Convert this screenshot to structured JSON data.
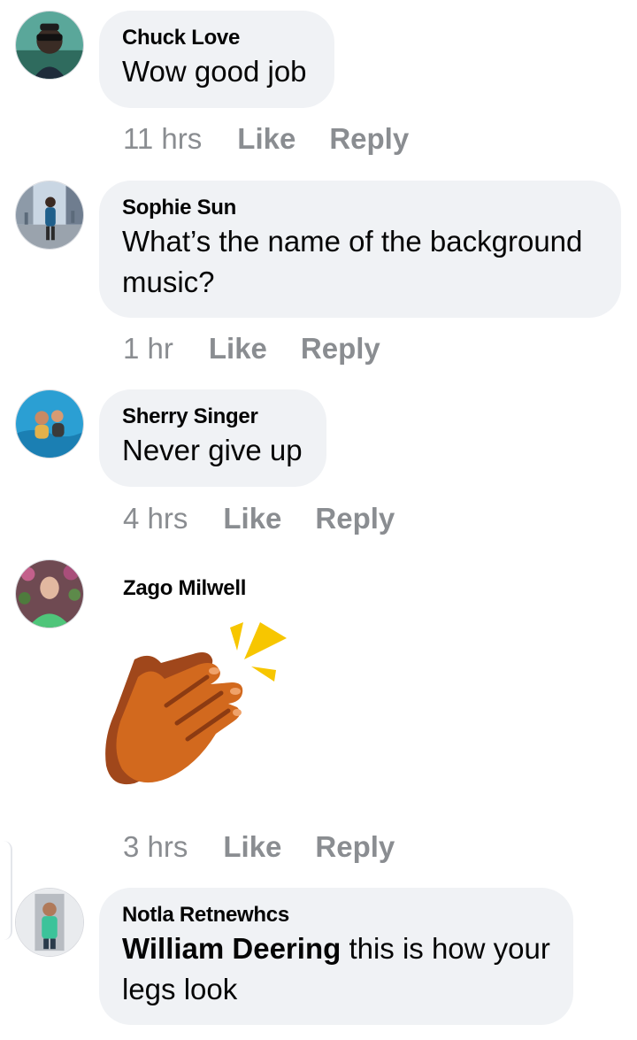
{
  "comments": [
    {
      "author": "Chuck Love",
      "text": "Wow good job",
      "time": "11 hrs",
      "like_label": "Like",
      "reply_label": "Reply"
    },
    {
      "author": "Sophie Sun",
      "text": "What’s the name of the background music?",
      "time": "1 hr",
      "like_label": "Like",
      "reply_label": "Reply"
    },
    {
      "author": "Sherry Singer",
      "text": "Never give up",
      "time": "4 hrs",
      "like_label": "Like",
      "reply_label": "Reply"
    },
    {
      "author": "Zago Milwell",
      "sticker": "clapping-hands",
      "time": "3 hrs",
      "like_label": "Like",
      "reply_label": "Reply"
    },
    {
      "author": "Notla Retnewhcs",
      "mention": "William Deering",
      "text": "this is how your legs look"
    }
  ],
  "colors": {
    "bubble_bg": "#f0f2f5",
    "meta_text": "#8a8d91",
    "clap_hand_front": "#d2691e",
    "clap_hand_back": "#a0471b",
    "clap_burst": "#f7c600"
  }
}
